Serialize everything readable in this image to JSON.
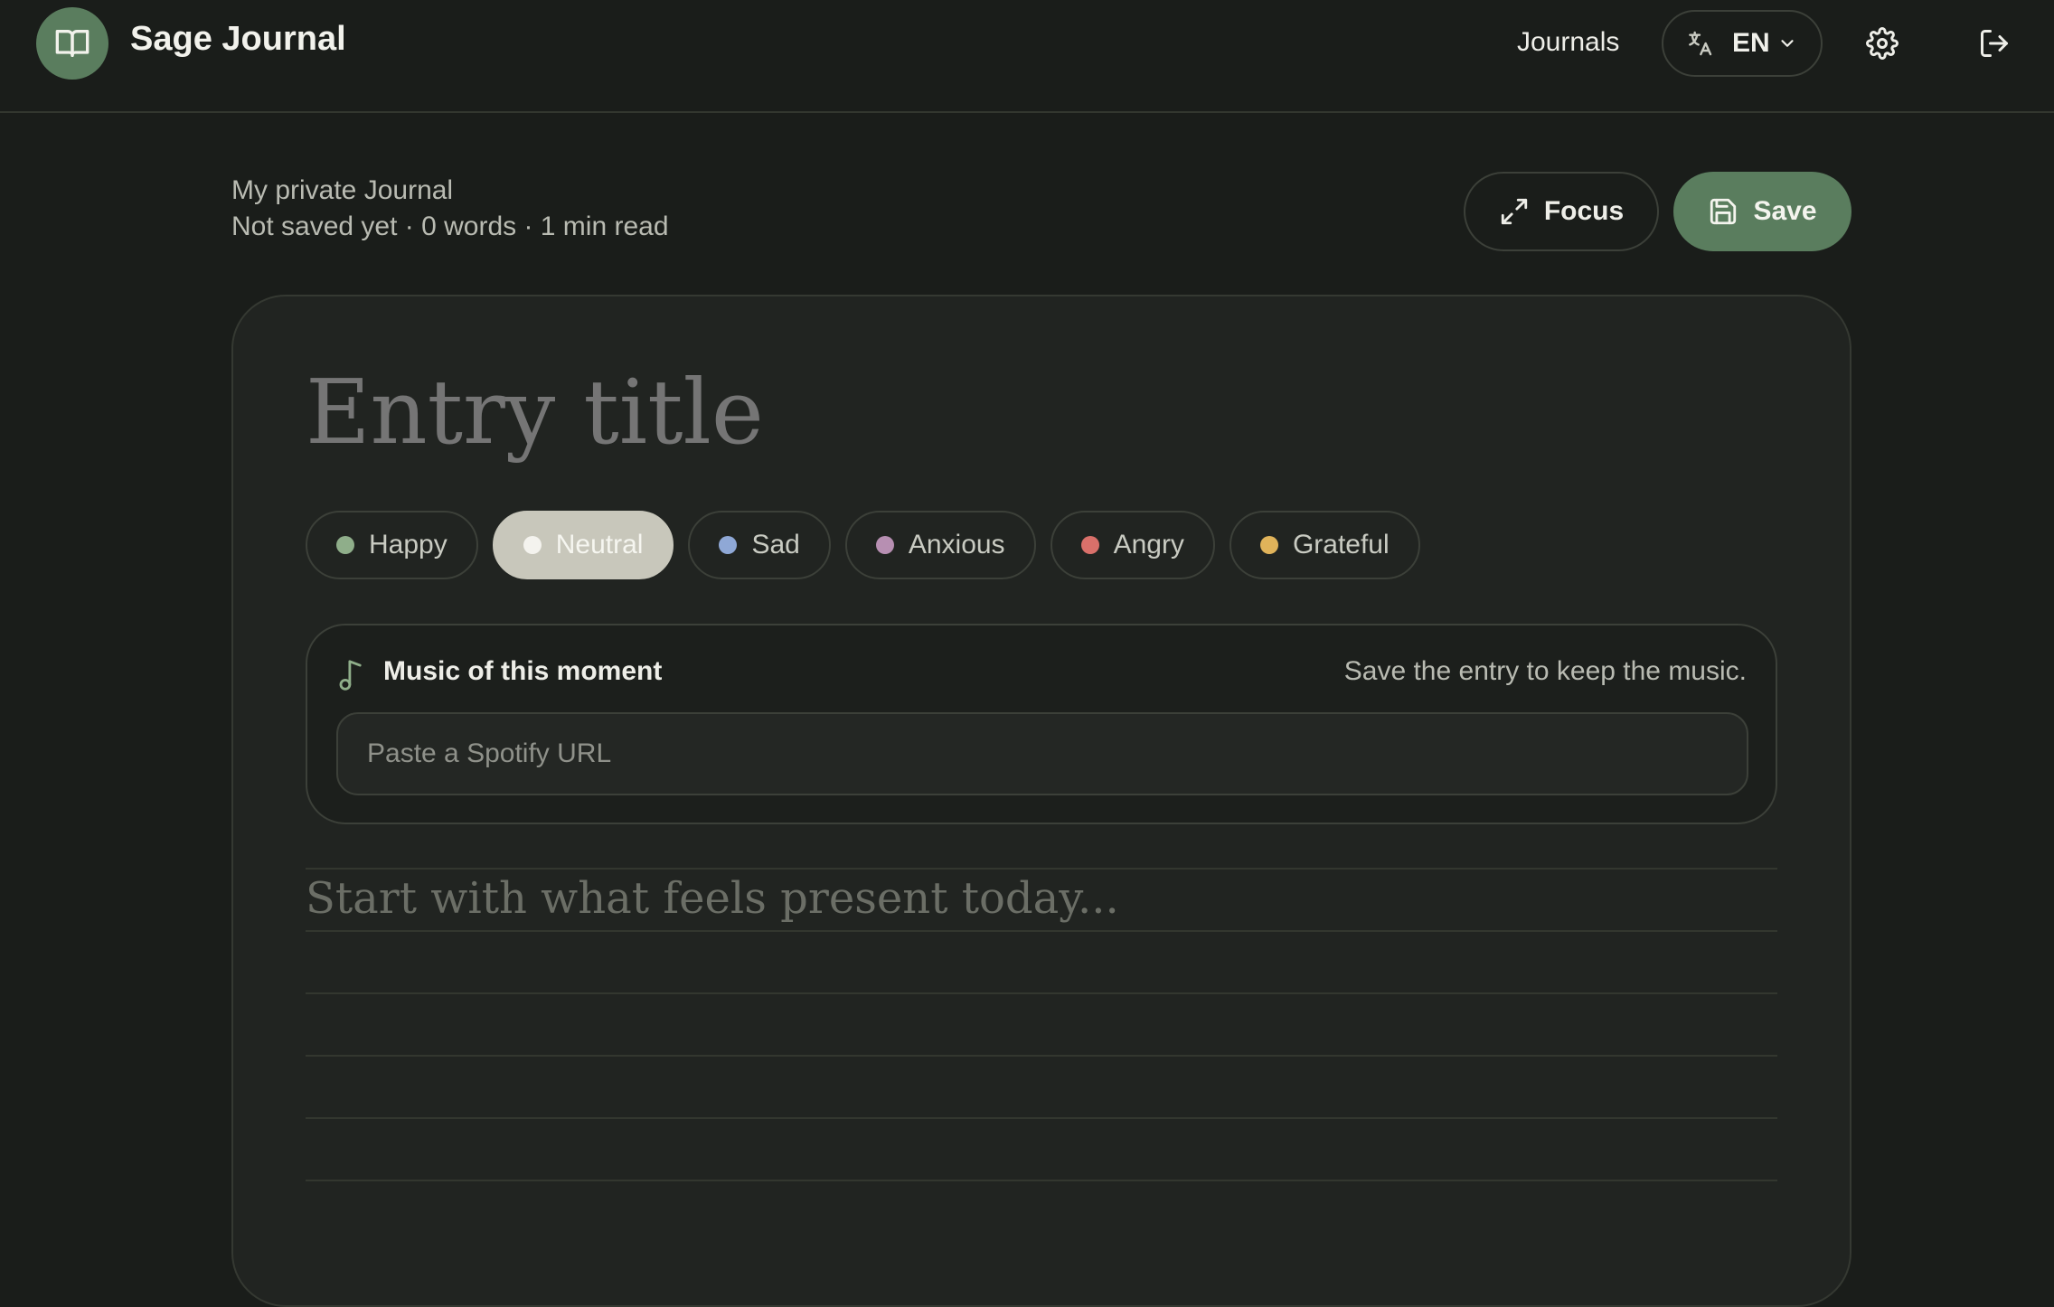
{
  "app": {
    "brand": "Sage Journal",
    "logo_icon": "book-open-icon"
  },
  "nav": {
    "journals_label": "Journals",
    "language": {
      "code": "EN",
      "icon": "translate-icon"
    },
    "settings_icon": "gear-icon",
    "logout_icon": "logout-icon"
  },
  "entry": {
    "journal_name": "My private Journal",
    "status": "Not saved yet · 0 words · 1 min read",
    "title_placeholder": "Entry title",
    "body_placeholder": "Start with what feels present today..."
  },
  "actions": {
    "focus_label": "Focus",
    "save_label": "Save"
  },
  "moods": [
    {
      "label": "Happy",
      "color": "#8fae8a",
      "active": false
    },
    {
      "label": "Neutral",
      "color": "#f4f3ee",
      "active": true
    },
    {
      "label": "Sad",
      "color": "#8fa8d6",
      "active": false
    },
    {
      "label": "Anxious",
      "color": "#b78fb2",
      "active": false
    },
    {
      "label": "Angry",
      "color": "#d9706a",
      "active": false
    },
    {
      "label": "Grateful",
      "color": "#e0b35a",
      "active": false
    }
  ],
  "music": {
    "title": "Music of this moment",
    "hint": "Save the entry to keep the music.",
    "input_placeholder": "Paste a Spotify URL",
    "input_value": ""
  },
  "colors": {
    "background": "#1a1d1a",
    "accent": "#5a7d5e",
    "card": "#212421"
  }
}
